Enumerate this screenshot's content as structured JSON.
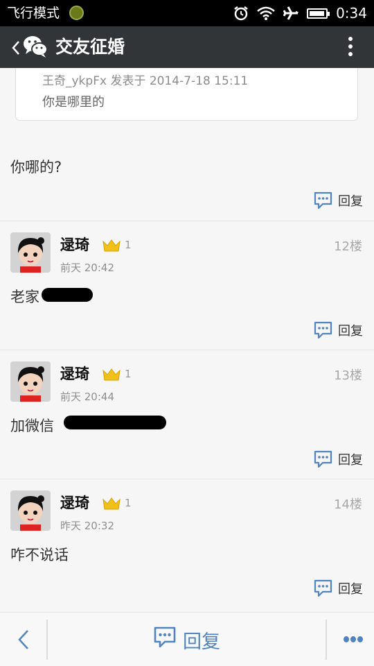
{
  "status_bar": {
    "mode_label": "飞行模式",
    "time": "0:34",
    "icons": [
      "game-icon",
      "alarm-icon",
      "wifi-icon",
      "airplane-icon",
      "battery-icon"
    ]
  },
  "header": {
    "title": "交友征婚",
    "icons": [
      "back-chevron-icon",
      "wechat-icon",
      "overflow-menu-icon"
    ]
  },
  "quote": {
    "meta": "王奇_ykpFx 发表于 2014-7-18 15:11",
    "text": "你是哪里的"
  },
  "first_reply": {
    "text": "你哪的?",
    "reply_label": "回复"
  },
  "posts": [
    {
      "username": "逯琦",
      "level": "1",
      "time": "前天 20:42",
      "floor": "12楼",
      "text": "老家",
      "reply_label": "回复"
    },
    {
      "username": "逯琦",
      "level": "1",
      "time": "前天 20:44",
      "floor": "13楼",
      "text": "加微信",
      "reply_label": "回复"
    },
    {
      "username": "逯琦",
      "level": "1",
      "time": "昨天 20:32",
      "floor": "14楼",
      "text": "咋不说话",
      "reply_label": "回复"
    }
  ],
  "bottom_bar": {
    "reply_label": "回复",
    "icons": [
      "back-arrow-icon",
      "reply-bubble-icon",
      "more-dots-icon"
    ]
  },
  "colors": {
    "header_bg": "#313537",
    "accent_blue": "#4f84c1",
    "crown_gold": "#f1c11a",
    "page_bg": "#f6f6f6"
  }
}
